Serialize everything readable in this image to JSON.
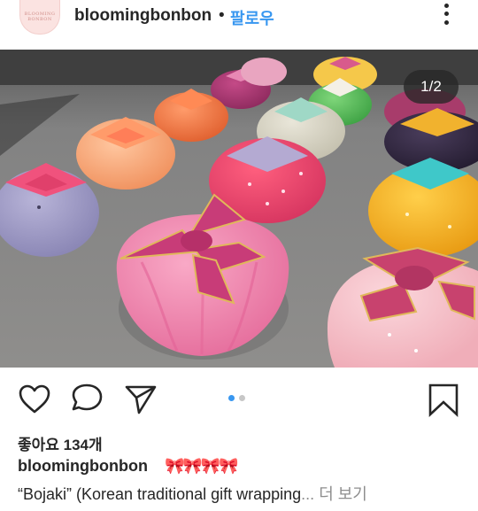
{
  "header": {
    "avatar_text_line1": "BLOOMING",
    "avatar_text_line2": "BONBON",
    "username": "bloomingbonbon",
    "separator": "•",
    "follow_label": "팔로우"
  },
  "post": {
    "image_alt": "Pink bojagi-wrapped fondant cakes on a grey table",
    "counter": "1/2",
    "carousel": {
      "total": 2,
      "active_index": 0
    }
  },
  "actions": {
    "like_icon": "heart-icon",
    "comment_icon": "comment-icon",
    "share_icon": "send-icon",
    "save_icon": "bookmark-icon"
  },
  "likes_label": "좋아요 134개",
  "caption": {
    "username": "bloomingbonbon",
    "emoji": "🎀🎀🎀🎀",
    "text": "“Bojaki” (Korean traditional gift wrapping",
    "ellipsis": "... ",
    "more_label": "더 보기"
  },
  "colors": {
    "follow": "#3897f0",
    "carousel_active": "#3897f0",
    "carousel_inactive": "#c7c7c7"
  }
}
